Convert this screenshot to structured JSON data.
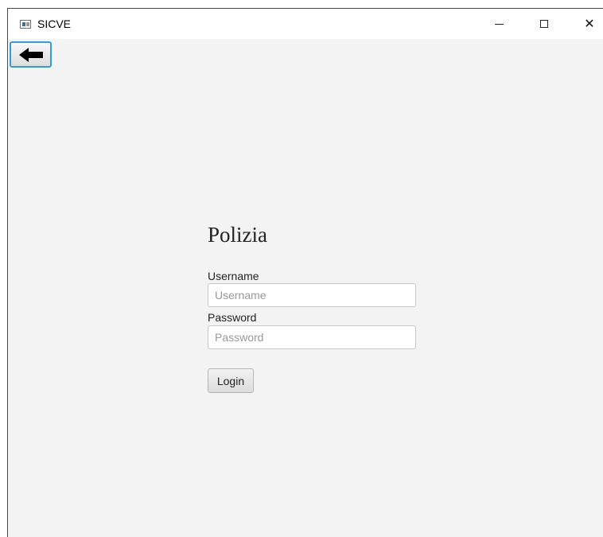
{
  "window": {
    "title": "SICVE",
    "controls": {
      "minimize_icon": "minimize-icon",
      "maximize_icon": "maximize-icon",
      "close_icon": "close-icon",
      "close_glyph": "✕"
    }
  },
  "toolbar": {
    "back_icon": "arrow-left-icon"
  },
  "login_form": {
    "title": "Polizia",
    "username_label": "Username",
    "username_placeholder": "Username",
    "username_value": "",
    "password_label": "Password",
    "password_placeholder": "Password",
    "password_value": "",
    "login_label": "Login"
  },
  "colors": {
    "background": "#f3f3f3",
    "titlebar": "#ffffff",
    "focus_border": "#3a9ad9"
  }
}
